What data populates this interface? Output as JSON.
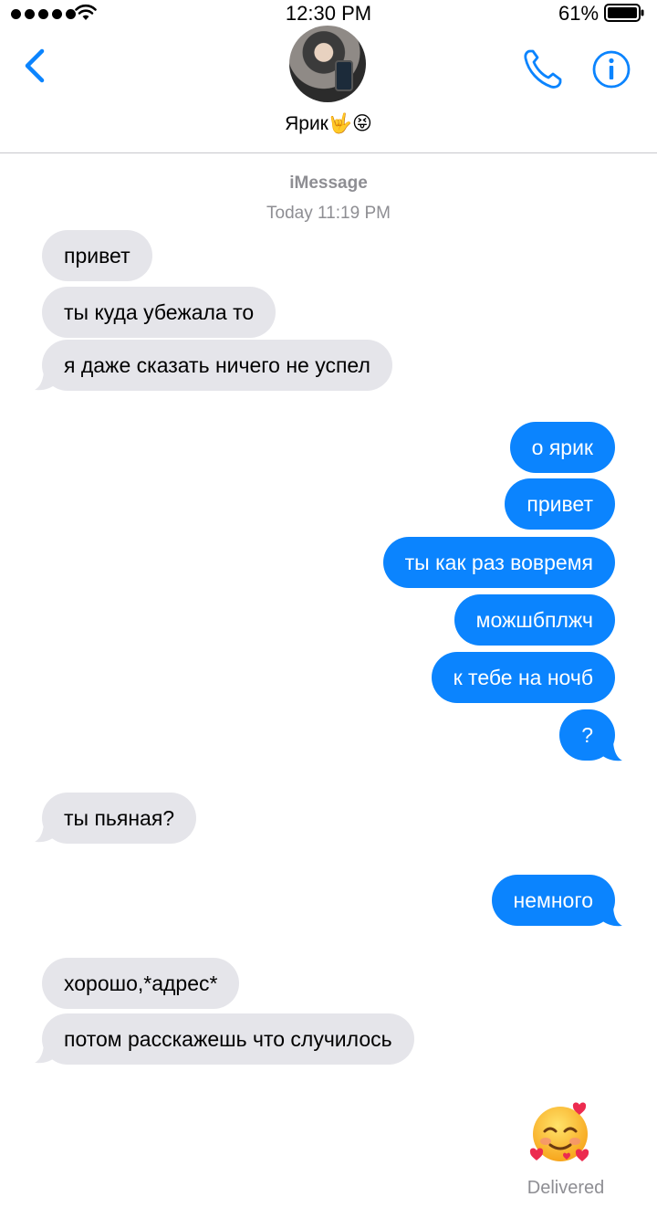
{
  "status_bar": {
    "time": "12:30 PM",
    "battery": "61%"
  },
  "header": {
    "contact_name": "Ярик🤟😝"
  },
  "thread": {
    "service": "iMessage",
    "timestamp": "Today 11:19 PM"
  },
  "messages": [
    {
      "text": "привет",
      "direction": "incoming"
    },
    {
      "text": "ты куда убежала то",
      "direction": "incoming"
    },
    {
      "text": "я даже сказать ничего не успел",
      "direction": "incoming"
    },
    {
      "text": "о ярик",
      "direction": "outgoing"
    },
    {
      "text": "привет",
      "direction": "outgoing"
    },
    {
      "text": "ты как раз вовремя",
      "direction": "outgoing"
    },
    {
      "text": "можшбплжч",
      "direction": "outgoing"
    },
    {
      "text": "к тебе на ночб",
      "direction": "outgoing"
    },
    {
      "text": "?",
      "direction": "outgoing"
    },
    {
      "text": "ты пьяная?",
      "direction": "incoming"
    },
    {
      "text": "немного",
      "direction": "outgoing"
    },
    {
      "text": "хорошо,*адрес*",
      "direction": "incoming"
    },
    {
      "text": "потом расскажешь что случилось",
      "direction": "incoming"
    }
  ],
  "last_message": {
    "emoji_name": "smiling-face-with-hearts-icon",
    "status": "Delivered"
  },
  "colors": {
    "accent": "#0b84fe",
    "incoming_bubble": "#e5e5ea",
    "meta_text": "#8e8e93"
  }
}
